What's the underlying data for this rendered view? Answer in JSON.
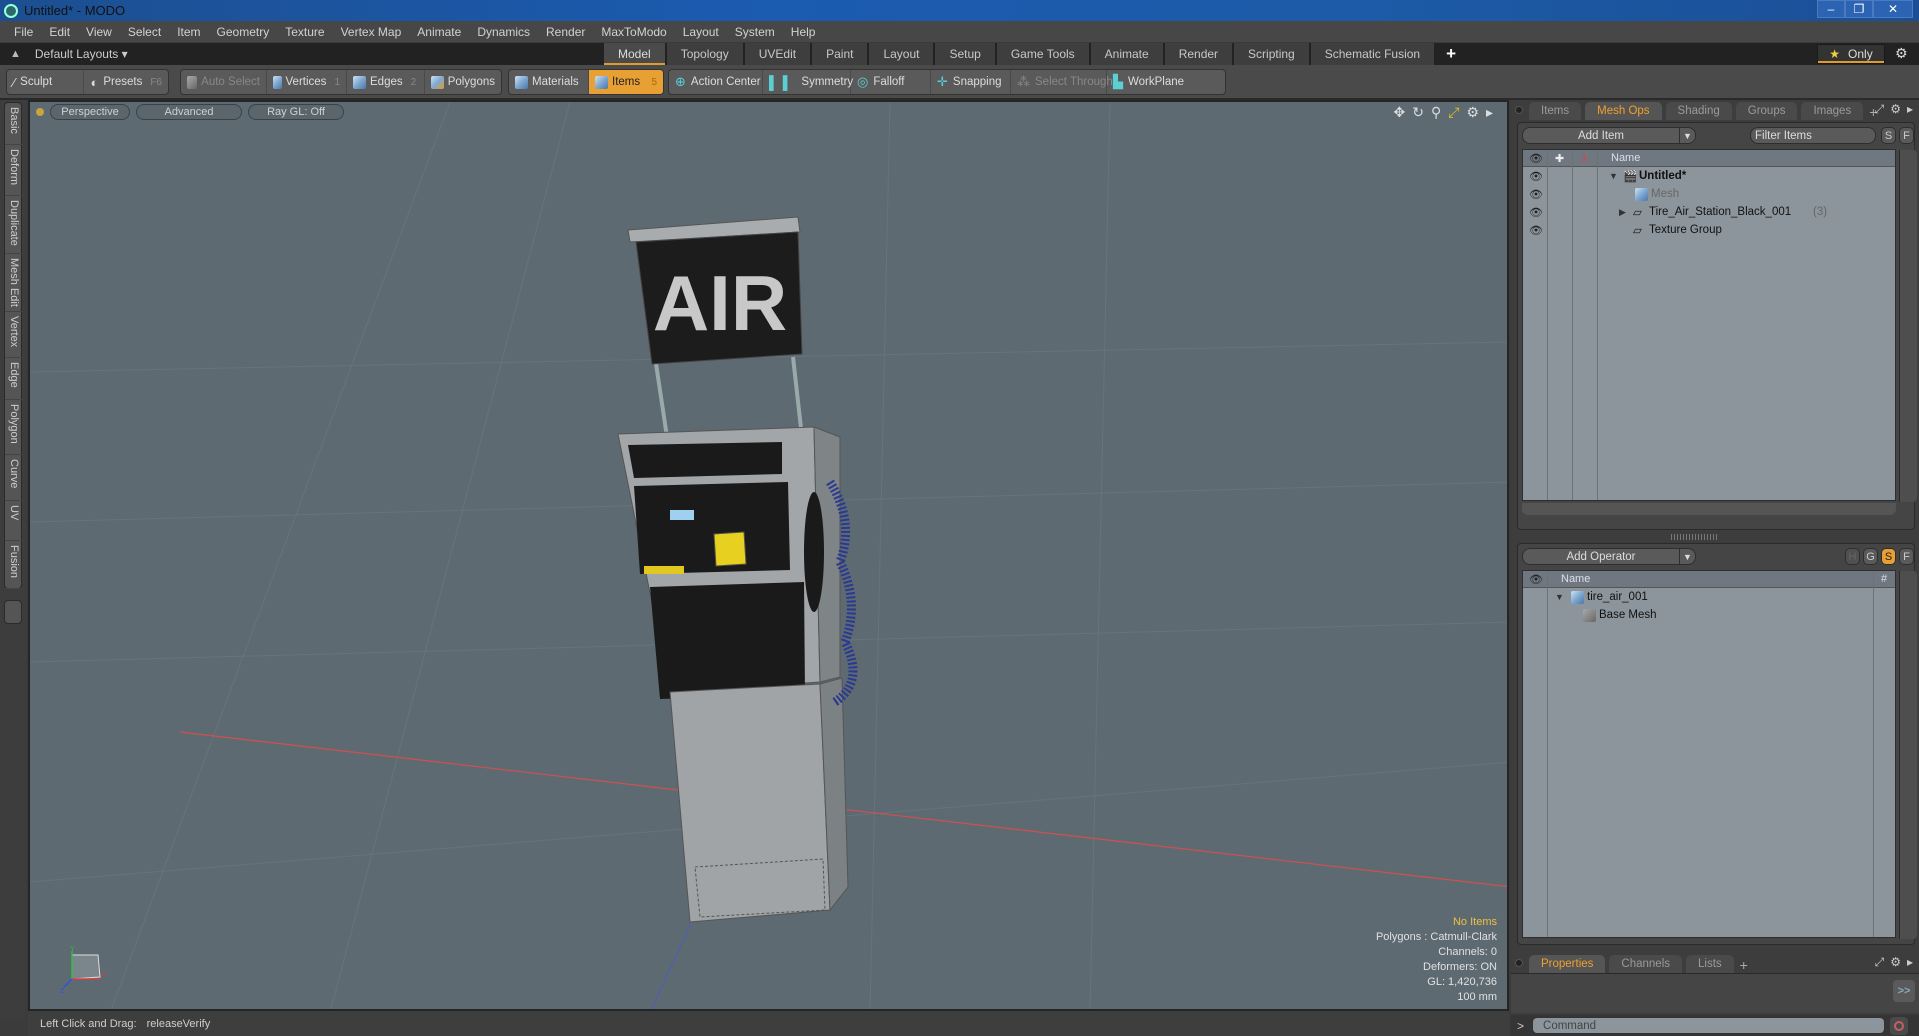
{
  "window": {
    "title": "Untitled* - MODO",
    "controls": {
      "minimize": "–",
      "restore": "❐",
      "close": "✕"
    }
  },
  "menu": [
    "File",
    "Edit",
    "View",
    "Select",
    "Item",
    "Geometry",
    "Texture",
    "Vertex Map",
    "Animate",
    "Dynamics",
    "Render",
    "MaxToModo",
    "Layout",
    "System",
    "Help"
  ],
  "layoutbar": {
    "layouts_label": "Default Layouts ▾",
    "tabs": [
      "Model",
      "Topology",
      "UVEdit",
      "Paint",
      "Layout",
      "Setup",
      "Game Tools",
      "Animate",
      "Render",
      "Scripting",
      "Schematic Fusion"
    ],
    "active_tab": "Model",
    "add_tab": "+",
    "only_label": "Only"
  },
  "toolbar": {
    "sculpt": "Sculpt",
    "presets": "Presets",
    "presets_hotkey": "F6",
    "auto_select": "Auto Select",
    "vertices": "Vertices",
    "vertices_hotkey": "1",
    "edges": "Edges",
    "edges_hotkey": "2",
    "polygons": "Polygons",
    "materials": "Materials",
    "items": "Items",
    "items_hotkey": "5",
    "action_center": "Action Center",
    "symmetry": "Symmetry",
    "falloff": "Falloff",
    "snapping": "Snapping",
    "select_through": "Select Through",
    "workplane": "WorkPlane"
  },
  "left_tabs": [
    "Basic",
    "Deform",
    "Duplicate",
    "Mesh Edit",
    "Vertex",
    "Edge",
    "Polygon",
    "Curve",
    "UV",
    "Fusion"
  ],
  "viewport": {
    "view": "Perspective",
    "shading": "Advanced",
    "raygl": "Ray GL: Off",
    "model_sign_text": "AIR",
    "stats": {
      "selection": "No Items",
      "polygons": "Polygons : Catmull-Clark",
      "channels": "Channels: 0",
      "deformers": "Deformers: ON",
      "gl": "GL: 1,420,736",
      "scale": "100 mm"
    },
    "axes": {
      "x": "X",
      "y": "Y",
      "z": "Z"
    }
  },
  "statusline": {
    "label": "Left Click and Drag:",
    "value": "releaseVerify"
  },
  "items_panel": {
    "tabs": [
      "Items",
      "Mesh Ops",
      "Shading",
      "Groups",
      "Images"
    ],
    "active_tab": "Mesh Ops",
    "add_item": "Add Item",
    "filter_placeholder": "Filter Items",
    "s_btn": "S",
    "f_btn": "F",
    "name_header": "Name",
    "tree": [
      {
        "name": "Untitled*",
        "type": "scene",
        "expanded": true
      },
      {
        "name": "Mesh",
        "type": "mesh",
        "dim": true
      },
      {
        "name": "Tire_Air_Station_Black_001",
        "count": "(3)",
        "type": "group",
        "collapsed": true
      },
      {
        "name": "Texture Group",
        "type": "group"
      }
    ]
  },
  "meshops_panel": {
    "add_operator": "Add Operator",
    "buttons": [
      "H",
      "G",
      "S",
      "F"
    ],
    "active_button": "S",
    "name_header": "Name",
    "hash_header": "#",
    "tree": [
      {
        "name": "tire_air_001",
        "expanded": true
      },
      {
        "name": "Base Mesh"
      }
    ]
  },
  "properties_panel": {
    "tabs": [
      "Properties",
      "Channels",
      "Lists"
    ],
    "active_tab": "Properties",
    "expand_btn": ">>"
  },
  "command": {
    "prompt": ">",
    "placeholder": "Command"
  },
  "colors": {
    "accent": "#e8a035",
    "viewport_bg": "#5e6a72",
    "list_bg": "#8d959c"
  }
}
